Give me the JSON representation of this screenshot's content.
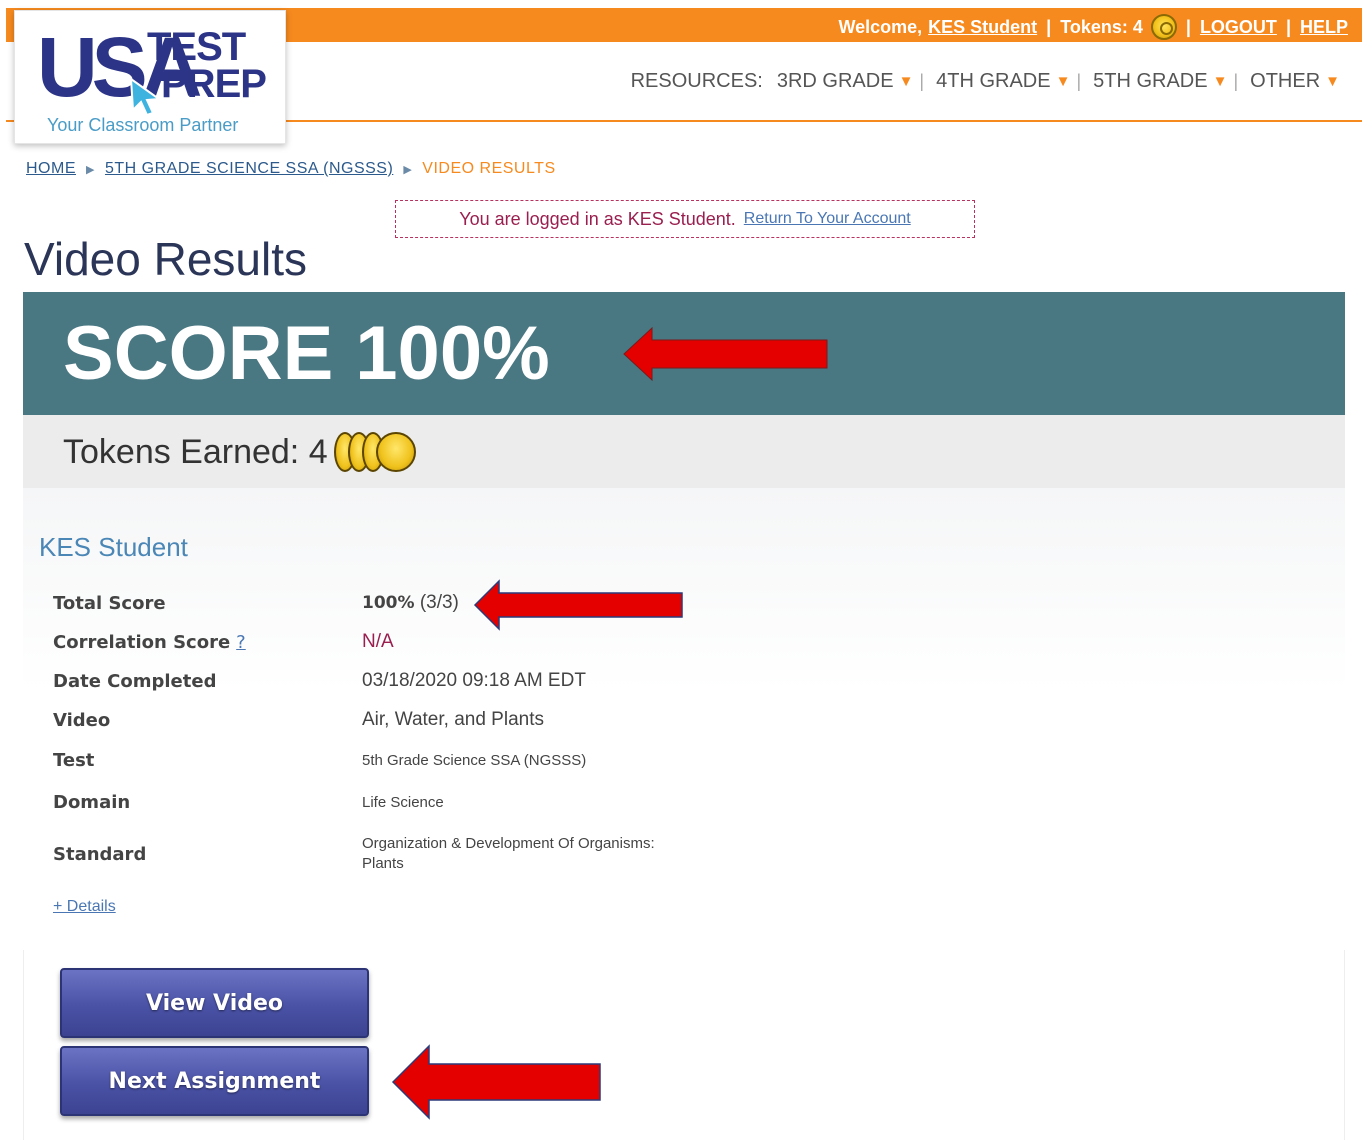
{
  "header": {
    "welcome_prefix": "Welcome,",
    "username": "KES Student",
    "tokens": "Tokens: 4",
    "logout": "LOGOUT",
    "help": "HELP"
  },
  "logo": {
    "usa": "USA",
    "test": "TEST",
    "prep": "PREP",
    "tagline": "Your Classroom Partner"
  },
  "nav": {
    "resources_label": "RESOURCES:",
    "items": [
      {
        "label": "3RD GRADE"
      },
      {
        "label": "4TH GRADE"
      },
      {
        "label": "5TH GRADE"
      },
      {
        "label": "OTHER"
      }
    ]
  },
  "breadcrumb": {
    "home": "HOME",
    "course": "5TH GRADE SCIENCE SSA (NGSSS)",
    "current": "VIDEO RESULTS"
  },
  "notice": {
    "text": "You are logged in as KES Student.",
    "link": "Return To Your Account"
  },
  "page_title": "Video Results",
  "score": {
    "label": "SCORE",
    "value": "100%"
  },
  "tokens_earned": {
    "label": "Tokens Earned: 4",
    "count": 4
  },
  "student": {
    "name": "KES Student",
    "rows": {
      "total_score": {
        "label": "Total Score",
        "value_bold": "100%",
        "value_rest": "(3/3)"
      },
      "correlation": {
        "label": "Correlation Score",
        "help": "?",
        "value": "N/A"
      },
      "date": {
        "label": "Date Completed",
        "value": "03/18/2020 09:18 AM EDT"
      },
      "video": {
        "label": "Video",
        "value": "Air, Water, and Plants"
      },
      "test": {
        "label": "Test",
        "value": "5th Grade Science SSA (NGSSS)"
      },
      "domain": {
        "label": "Domain",
        "value": "Life Science"
      },
      "standard": {
        "label": "Standard",
        "value_line1": "Organization & Development Of Organisms:",
        "value_line2": "Plants"
      }
    },
    "details_link": "+ Details"
  },
  "buttons": {
    "view_video": "View Video",
    "next_assignment": "Next Assignment"
  },
  "colors": {
    "orange": "#f68a1f",
    "navy": "#2c3487",
    "banner": "#497782",
    "button": "#4a52a6",
    "arrow": "#e50000"
  }
}
